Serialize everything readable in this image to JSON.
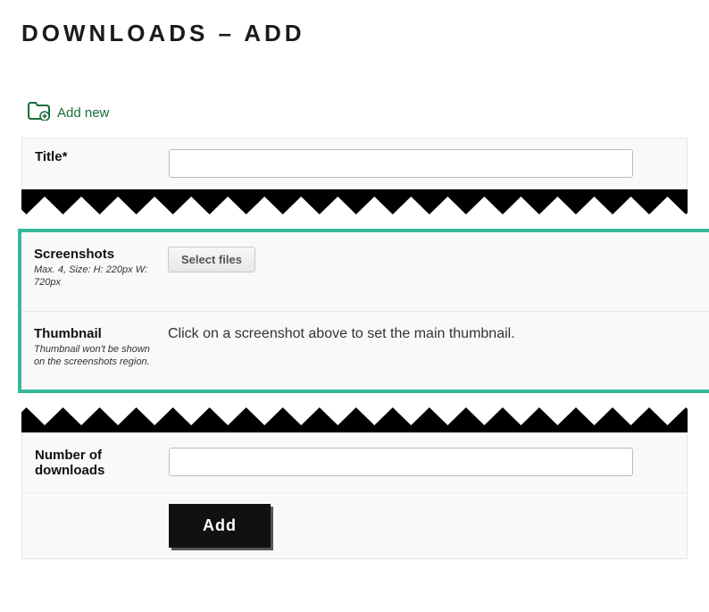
{
  "page_title": "DOWNLOADS – ADD",
  "add_new": "Add new",
  "title_field": {
    "label": "Title*",
    "value": ""
  },
  "screenshots": {
    "label": "Screenshots",
    "sub": "Max. 4, Size: H: 220px W: 720px",
    "button": "Select files"
  },
  "thumbnail": {
    "label": "Thumbnail",
    "sub": "Thumbnail won't be shown on the screenshots region.",
    "text": "Click on a screenshot above to set the main thumbnail."
  },
  "num_downloads": {
    "label": "Number of downloads",
    "value": ""
  },
  "add_button": "Add"
}
